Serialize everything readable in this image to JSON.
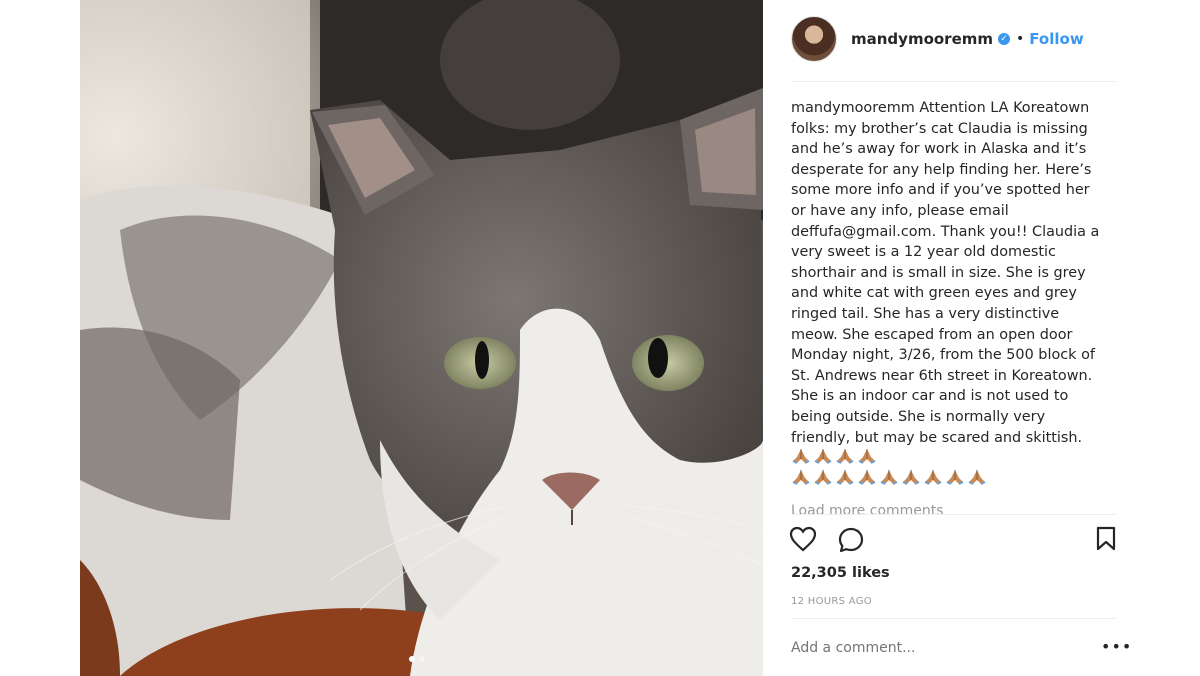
{
  "post": {
    "username": "mandymooremm",
    "follow_label": "Follow",
    "separator": "•",
    "caption_user": "mandymooremm",
    "caption_text": "Attention LA Koreatown folks: my brother’s cat Claudia is missing and he’s away for work in Alaska and it’s desperate for any help finding her. Here’s some more info and if you’ve spotted her or have any info, please email deffufa@gmail.com. Thank you!! Claudia a very sweet is a 12 year old domestic shorthair and is small in size. She is grey and white cat with green eyes and grey ringed tail. She has a very distinctive meow. She escaped from an open door Monday night, 3/26, from the 500 block of St. Andrews near 6th street in Koreatown. She is an indoor car and is not used to being outside. She is normally very friendly, but may be scared and skittish.",
    "emoji_inline_count": 4,
    "emoji_row_count": 9,
    "emoji_name": "folded-hands",
    "load_more": "Load more comments",
    "likes": "22,305 likes",
    "timestamp": "12 HOURS AGO",
    "comment_placeholder": "Add a comment...",
    "more_label": "•••",
    "carousel_slides": 2,
    "carousel_active": 1
  },
  "icons": [
    "heart-icon",
    "comment-icon",
    "bookmark-icon",
    "verified-icon",
    "more-icon"
  ],
  "colors": {
    "accent": "#3897f0",
    "text": "#262626",
    "muted": "#999999"
  }
}
